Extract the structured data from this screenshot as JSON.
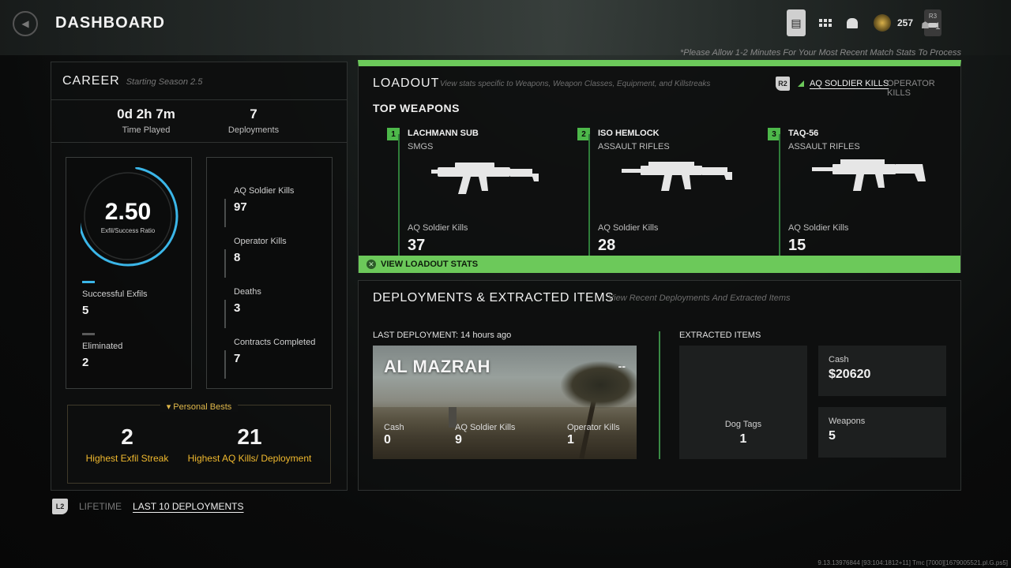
{
  "header": {
    "title": "DASHBOARD",
    "currency_count": "257",
    "r3_label": "R3",
    "party_count": "1",
    "notice": "*Please Allow 1-2 Minutes For Your Most Recent Match Stats To Process"
  },
  "career": {
    "title": "CAREER",
    "subtitle": "Starting Season 2.5",
    "time_played": {
      "value": "0d 2h 7m",
      "label": "Time Played"
    },
    "deployments": {
      "value": "7",
      "label": "Deployments"
    },
    "ratio": {
      "value": "2.50",
      "label": "Exfil/Success Ratio",
      "fill_fraction": 0.71
    },
    "successful_exfils": {
      "label": "Successful Exfils",
      "value": "5"
    },
    "eliminated": {
      "label": "Eliminated",
      "value": "2"
    },
    "right_stats": [
      {
        "label": "AQ Soldier Kills",
        "value": "97"
      },
      {
        "label": "Operator Kills",
        "value": "8"
      },
      {
        "label": "Deaths",
        "value": "3"
      },
      {
        "label": "Contracts Completed",
        "value": "7"
      }
    ],
    "personal_bests": {
      "title": "Personal Bests",
      "items": [
        {
          "value": "2",
          "label": "Highest Exfil Streak"
        },
        {
          "value": "21",
          "label": "Highest AQ Kills/ Deployment"
        }
      ]
    }
  },
  "toggle": {
    "button": "L2",
    "lifetime": "LIFETIME",
    "last10": "LAST 10 DEPLOYMENTS"
  },
  "loadout": {
    "title": "LOADOUT",
    "subtitle": "View stats specific to Weapons, Weapon Classes, Equipment, and Killstreaks",
    "r2_label": "R2",
    "tab_active": "AQ SOLDIER KILLS",
    "tab_inactive": "OPERATOR KILLS",
    "top_weapons_title": "TOP WEAPONS",
    "weapons": [
      {
        "rank": "1",
        "name": "LACHMANN SUB",
        "class": "SMGS",
        "kills_label": "AQ Soldier Kills",
        "kills": "37"
      },
      {
        "rank": "2",
        "name": "ISO HEMLOCK",
        "class": "ASSAULT RIFLES",
        "kills_label": "AQ Soldier Kills",
        "kills": "28"
      },
      {
        "rank": "3",
        "name": "TAQ-56",
        "class": "ASSAULT RIFLES",
        "kills_label": "AQ Soldier Kills",
        "kills": "15"
      }
    ],
    "view_button": "VIEW LOADOUT STATS",
    "accent": "#6cc95a"
  },
  "deployments": {
    "title": "DEPLOYMENTS & EXTRACTED ITEMS",
    "subtitle": "View Recent Deployments And Extracted Items",
    "last_deployment": "LAST DEPLOYMENT: 14 hours ago",
    "map": {
      "name": "AL MAZRAH",
      "result": "--",
      "stats": [
        {
          "label": "Cash",
          "value": "0"
        },
        {
          "label": "AQ Soldier Kills",
          "value": "9"
        },
        {
          "label": "Operator Kills",
          "value": "1"
        }
      ]
    },
    "extracted_title": "EXTRACTED ITEMS",
    "dog_tags": {
      "label": "Dog Tags",
      "value": "1"
    },
    "cash": {
      "label": "Cash",
      "value": "$20620"
    },
    "weapons": {
      "label": "Weapons",
      "value": "5"
    }
  },
  "version": "9.13.13976844 [93:104:1812+11] Tmc [7000][1679005521.pl.G.ps5]"
}
